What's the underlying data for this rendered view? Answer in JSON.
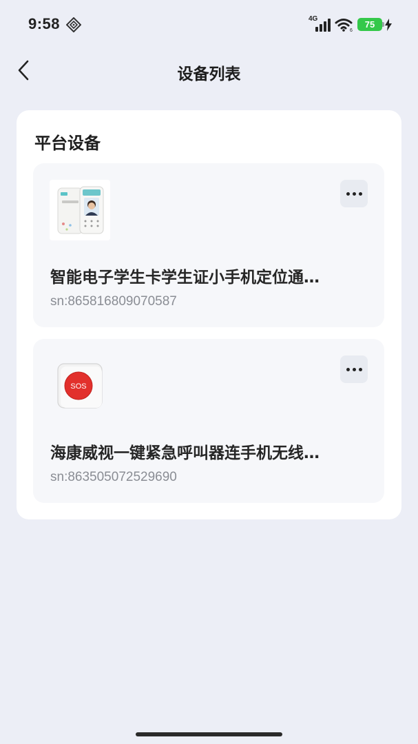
{
  "status_bar": {
    "time": "9:58",
    "network": "4G",
    "battery_level": "75",
    "battery_color": "#34c84a",
    "icons": [
      "diamond-icon",
      "signal-icon",
      "wifi-icon",
      "charging-icon"
    ]
  },
  "header": {
    "title": "设备列表",
    "back_icon": "chevron-left-icon"
  },
  "section": {
    "title": "平台设备",
    "devices": [
      {
        "name": "智能电子学生卡学生证小手机定位通…",
        "sn": "sn:865816809070587",
        "image": "student-card-phone-image",
        "more_icon": "more-horizontal-icon"
      },
      {
        "name": "海康威视一键紧急呼叫器连手机无线…",
        "sn": "sn:863505072529690",
        "image": "sos-button-image",
        "sos_label": "SOS",
        "more_icon": "more-horizontal-icon"
      }
    ]
  },
  "colors": {
    "background": "#eceef6",
    "card": "#ffffff",
    "device_card": "#f6f7fa",
    "sos_red": "#e2302c"
  }
}
